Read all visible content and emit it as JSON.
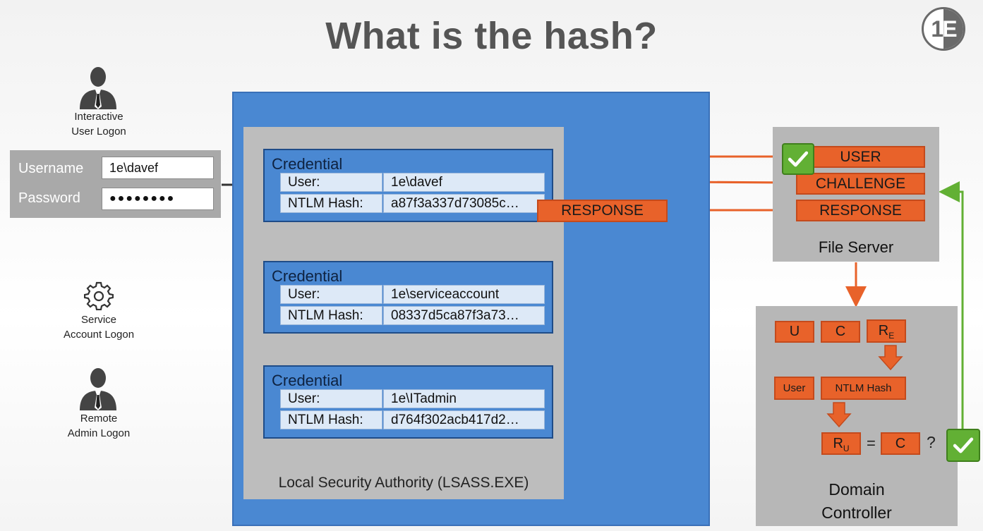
{
  "title": "What is the hash?",
  "logo": {
    "text_a": "1",
    "text_b": "E"
  },
  "logons": {
    "interactive": {
      "line1": "Interactive",
      "line2": "User Logon"
    },
    "service": {
      "line1": "Service",
      "line2": "Account Logon"
    },
    "remote": {
      "line1": "Remote",
      "line2": "Admin Logon"
    }
  },
  "login_form": {
    "username_label": "Username",
    "username_value": "1e\\davef",
    "password_label": "Password",
    "password_value": "●●●●●●●●"
  },
  "lsass": {
    "label": "Local Security Authority (LSASS.EXE)",
    "credentials": [
      {
        "title": "Credential",
        "user_label": "User:",
        "user_value": "1e\\davef",
        "hash_label": "NTLM Hash:",
        "hash_value": "a87f3a337d73085c…"
      },
      {
        "title": "Credential",
        "user_label": "User:",
        "user_value": "1e\\serviceaccount",
        "hash_label": "NTLM Hash:",
        "hash_value": "08337d5ca87f3a73…"
      },
      {
        "title": "Credential",
        "user_label": "User:",
        "user_value": "1e\\ITadmin",
        "hash_label": "NTLM Hash:",
        "hash_value": "d764f302acb417d2…"
      }
    ]
  },
  "response_label": "RESPONSE",
  "file_server": {
    "label": "File Server",
    "user": "USER",
    "challenge": "CHALLENGE",
    "response": "RESPONSE"
  },
  "domain_controller": {
    "label_line1": "Domain",
    "label_line2": "Controller",
    "u": "U",
    "c": "C",
    "re_main": "R",
    "re_sub": "E",
    "user": "User",
    "ntlm_hash": "NTLM Hash",
    "ru_main": "R",
    "ru_sub": "U",
    "equals": "=",
    "c2": "C",
    "question": "?"
  },
  "colors": {
    "lsass_blue": "#4a88d2",
    "orange": "#e8622a",
    "green": "#62b034",
    "arrow_orange": "#e8622a",
    "arrow_green": "#62b034"
  }
}
